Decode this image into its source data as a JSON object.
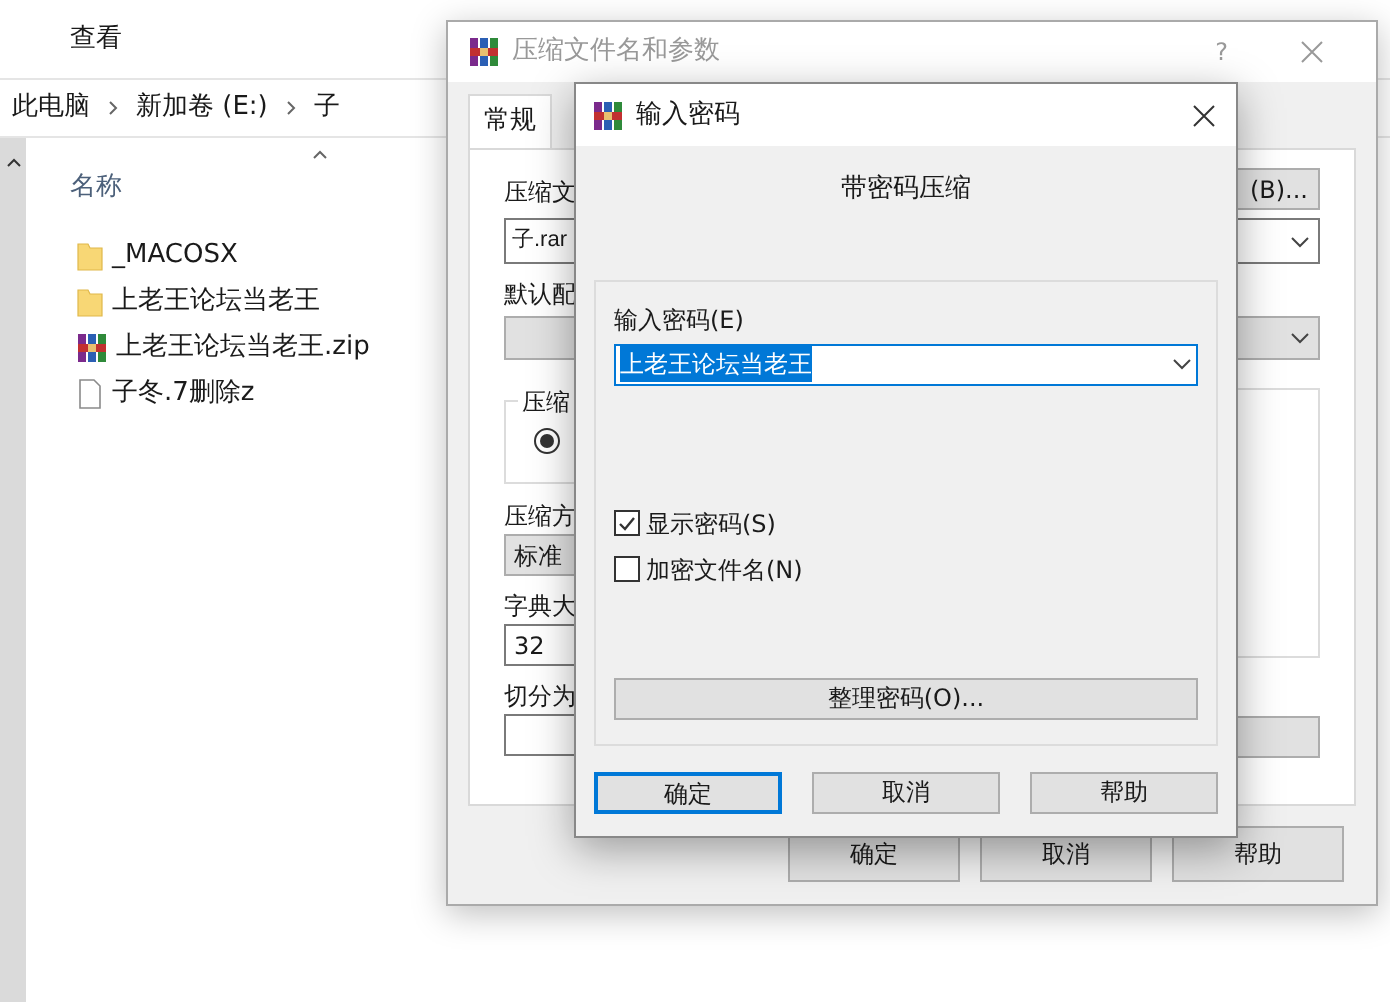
{
  "explorer": {
    "menu": [
      "查看"
    ],
    "breadcrumb": [
      "此电脑",
      "新加卷 (E:)",
      "子"
    ],
    "column_header": "名称",
    "files": [
      {
        "name": "_MACOSX",
        "kind": "folder"
      },
      {
        "name": "上老王论坛当老王",
        "kind": "folder"
      },
      {
        "name": "上老王论坛当老王.zip",
        "kind": "archive"
      },
      {
        "name": "子冬.7删除z",
        "kind": "file"
      }
    ]
  },
  "archive_dialog": {
    "title": "压缩文件名和参数",
    "help": "?",
    "tabs": [
      {
        "label": "常规",
        "selected": true
      }
    ],
    "archive_name_label": "压缩文",
    "browse_button": "(B)...",
    "archive_name": "子.rar",
    "profile_label": "默认配",
    "format_group_label": "压缩",
    "format_radio": {
      "selected": true
    },
    "method_label": "压缩方",
    "method": "标准",
    "dictionary_label": "字典大",
    "dictionary": "32",
    "split_label": "切分为",
    "buttons": [
      "确定",
      "取消",
      "帮助"
    ]
  },
  "password_dialog": {
    "title": "输入密码",
    "heading": "带密码压缩",
    "password_label": "输入密码(E)",
    "password": "上老王论坛当老王",
    "options": [
      {
        "label": "显示密码(S)",
        "checked": true
      },
      {
        "label": "加密文件名(N)",
        "checked": false
      }
    ],
    "organize_button": "整理密码(O)...",
    "buttons": [
      {
        "label": "确定",
        "default": true
      },
      {
        "label": "取消",
        "default": false
      },
      {
        "label": "帮助",
        "default": false
      }
    ]
  }
}
